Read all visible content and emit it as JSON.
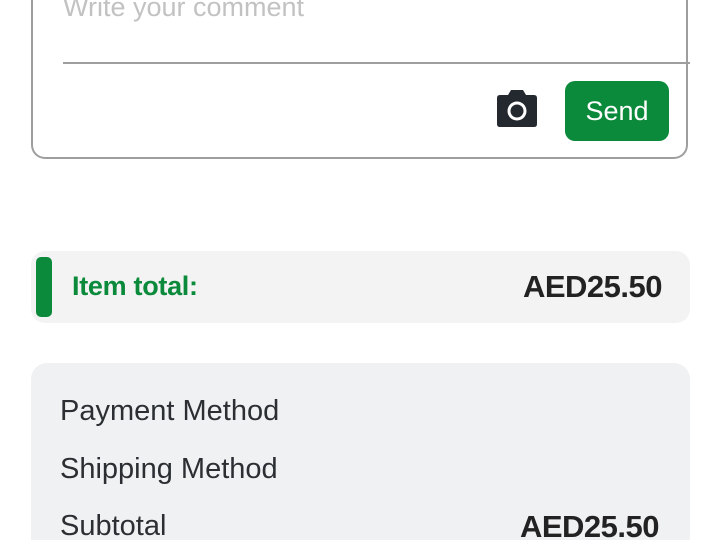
{
  "comment": {
    "placeholder": "Write your comment",
    "value": "",
    "send_label": "Send",
    "camera_icon": "camera-icon"
  },
  "item_total": {
    "label": "Item total:",
    "value": "AED25.50"
  },
  "summary": {
    "payment_method_label": "Payment Method",
    "shipping_method_label": "Shipping Method",
    "subtotal_label": "Subtotal",
    "subtotal_value": "AED25.50"
  },
  "colors": {
    "accent": "#0a8a3a",
    "text": "#222222",
    "card_bg": "#f0f1f3"
  }
}
